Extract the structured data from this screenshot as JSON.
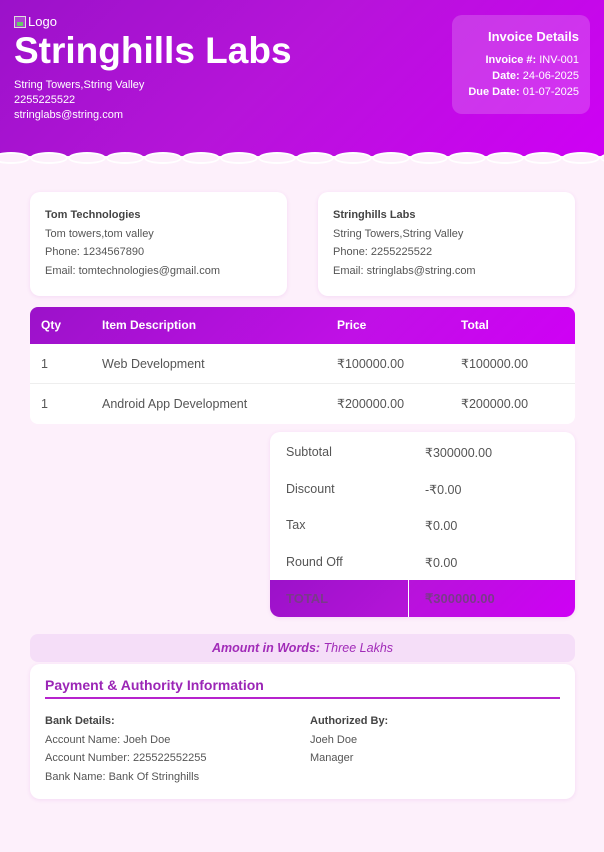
{
  "header": {
    "logo_alt": "Logo",
    "company_name": "Stringhills Labs",
    "address": "String Towers,String Valley",
    "phone": "2255225522",
    "email": "stringlabs@string.com",
    "brand_color": "#b614d9"
  },
  "invoice": {
    "title": "Invoice Details",
    "number_label": "Invoice #:",
    "number": "INV-001",
    "date_label": "Date:",
    "date": "24-06-2025",
    "due_label": "Due Date:",
    "due_date": "01-07-2025"
  },
  "bill_to": {
    "name": "Tom Technologies",
    "address": "Tom towers,tom valley",
    "phone": "Phone: 1234567890",
    "email": "Email: tomtechnologies@gmail.com"
  },
  "from": {
    "name": "Stringhills Labs",
    "address": "String Towers,String Valley",
    "phone": "Phone: 2255225522",
    "email": "Email: stringlabs@string.com"
  },
  "items_table": {
    "headers": [
      "Qty",
      "Item Description",
      "Price",
      "Total"
    ],
    "rows": [
      [
        "1",
        "Web Development",
        "₹100000.00",
        "₹100000.00"
      ],
      [
        "1",
        "Android App Development",
        "₹200000.00",
        "₹200000.00"
      ]
    ]
  },
  "totals": {
    "subtotal_label": "Subtotal",
    "subtotal": "₹300000.00",
    "discount_label": "Discount",
    "discount": "-₹0.00",
    "tax_label": "Tax",
    "tax": "₹0.00",
    "roundoff_label": "Round Off",
    "roundoff": "₹0.00",
    "total_label": "TOTAL",
    "total": "₹300000.00"
  },
  "amount_words": {
    "label": "Amount in Words:",
    "value": "Three Lakhs"
  },
  "payment": {
    "title": "Payment & Authority Information",
    "bank_heading": "Bank Details:",
    "account_name": "Account Name: Joeh Doe",
    "account_number": "Account Number: 225522552255",
    "bank_name": "Bank Name: Bank Of Stringhills",
    "auth_heading": "Authorized By:",
    "auth_name": "Joeh Doe",
    "auth_role": "Manager"
  }
}
